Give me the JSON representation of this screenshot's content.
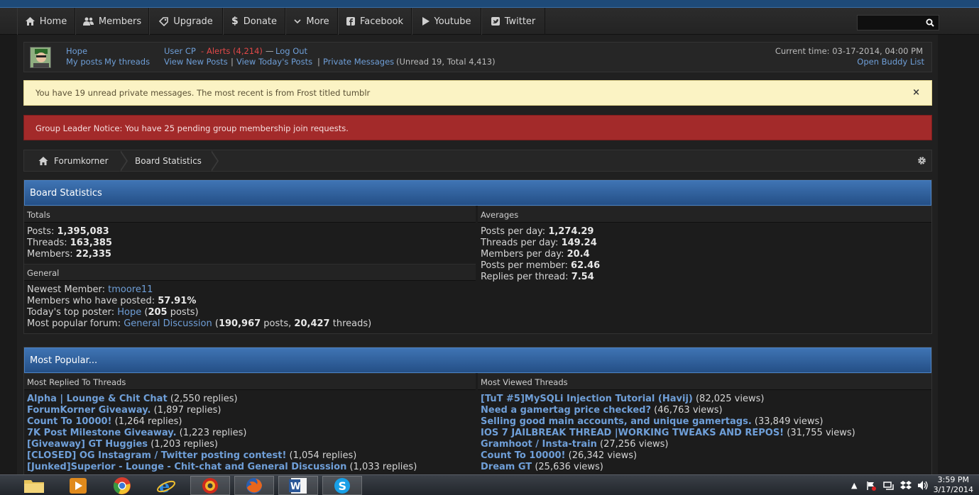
{
  "nav": {
    "items": [
      {
        "label": "Home",
        "icon": "home-icon"
      },
      {
        "label": "Members",
        "icon": "members-icon"
      },
      {
        "label": "Upgrade",
        "icon": "tag-icon"
      },
      {
        "label": "Donate",
        "icon": "dollar-icon"
      },
      {
        "label": "More",
        "icon": "chevron-down-icon"
      },
      {
        "label": "Facebook",
        "icon": "facebook-icon"
      },
      {
        "label": "Youtube",
        "icon": "play-icon"
      },
      {
        "label": "Twitter",
        "icon": "twitter-icon"
      }
    ],
    "search_placeholder": ""
  },
  "userpanel": {
    "username": "Hope",
    "my_posts": "My posts",
    "my_threads": "My threads",
    "user_cp": "User CP",
    "dash": "-",
    "alerts": "Alerts (4,214)",
    "emdash": "—",
    "logout": "Log Out",
    "view_new_posts": "View New Posts",
    "pipe": "|",
    "view_todays_posts": "View Today's Posts",
    "private_messages": "Private Messages",
    "pm_counts": "(Unread 19, Total 4,413)",
    "current_time": "Current time: 03-17-2014, 04:00 PM",
    "open_buddy_list": "Open Buddy List"
  },
  "notices": {
    "pm_notice": "You have 19 unread private messages. The most recent is from Frost titled tumblr",
    "close": "×",
    "group_notice": "Group Leader Notice: You have 25 pending group membership join requests."
  },
  "breadcrumb": {
    "home": "Forumkorner",
    "current": "Board Statistics"
  },
  "board_stats": {
    "title": "Board Statistics",
    "totals_head": "Totals",
    "posts_label": "Posts:",
    "posts": "1,395,083",
    "threads_label": "Threads:",
    "threads": "163,385",
    "members_label": "Members:",
    "members": "22,335",
    "general_head": "General",
    "newest_label": "Newest Member:",
    "newest": "tmoore11",
    "posted_label": "Members who have posted:",
    "posted": "57.91%",
    "top_label": "Today's top poster:",
    "top_user": "Hope",
    "top_open": "(",
    "top_posts": "205",
    "top_close": " posts)",
    "popular_label": "Most popular forum:",
    "popular_forum": "General Discussion",
    "popular_open": "(",
    "popular_posts": "190,967",
    "popular_mid": " posts, ",
    "popular_threads": "20,427",
    "popular_close": " threads)",
    "averages_head": "Averages",
    "ppd_label": "Posts per day:",
    "ppd": "1,274.29",
    "tpd_label": "Threads per day:",
    "tpd": "149.24",
    "mpd_label": "Members per day:",
    "mpd": "20.4",
    "ppm_label": "Posts per member:",
    "ppm": "62.46",
    "rpt_label": "Replies per thread:",
    "rpt": "7.54"
  },
  "most_popular": {
    "title": "Most Popular...",
    "replied_head": "Most Replied To Threads",
    "viewed_head": "Most Viewed Threads",
    "replied": [
      {
        "title": "Alpha | Lounge & Chit Chat",
        "count": "(2,550 replies)"
      },
      {
        "title": "ForumKorner Giveaway.",
        "count": "(1,897 replies)"
      },
      {
        "title": "Count To 10000!",
        "count": "(1,264 replies)"
      },
      {
        "title": "7K Post Milestone Giveaway.",
        "count": "(1,223 replies)"
      },
      {
        "title": "[Giveaway] GT Huggies",
        "count": "(1,203 replies)"
      },
      {
        "title": "[CLOSED] OG Instagram / Twitter posting contest!",
        "count": "(1,054 replies)"
      },
      {
        "title": "[Junked]Superior - Lounge - Chit-chat and General Discussion",
        "count": "(1,033 replies)"
      }
    ],
    "viewed": [
      {
        "title": "[TuT #5]MySQLi Injection Tutorial (Havij)",
        "count": "(82,025 views)"
      },
      {
        "title": "Need a gamertag price checked?",
        "count": "(46,763 views)"
      },
      {
        "title": "Selling good main accounts, and unique gamertags.",
        "count": "(33,849 views)"
      },
      {
        "title": "IOS 7 JAILBREAK THREAD |WORKING TWEAKS AND REPOS!",
        "count": "(31,755 views)"
      },
      {
        "title": "Gramhoot / Insta-train",
        "count": "(27,256 views)"
      },
      {
        "title": "Count To 10000!",
        "count": "(26,342 views)"
      },
      {
        "title": "Dream GT",
        "count": "(25,636 views)"
      }
    ]
  },
  "taskbar": {
    "time": "3:59 PM",
    "date": "3/17/2014"
  }
}
